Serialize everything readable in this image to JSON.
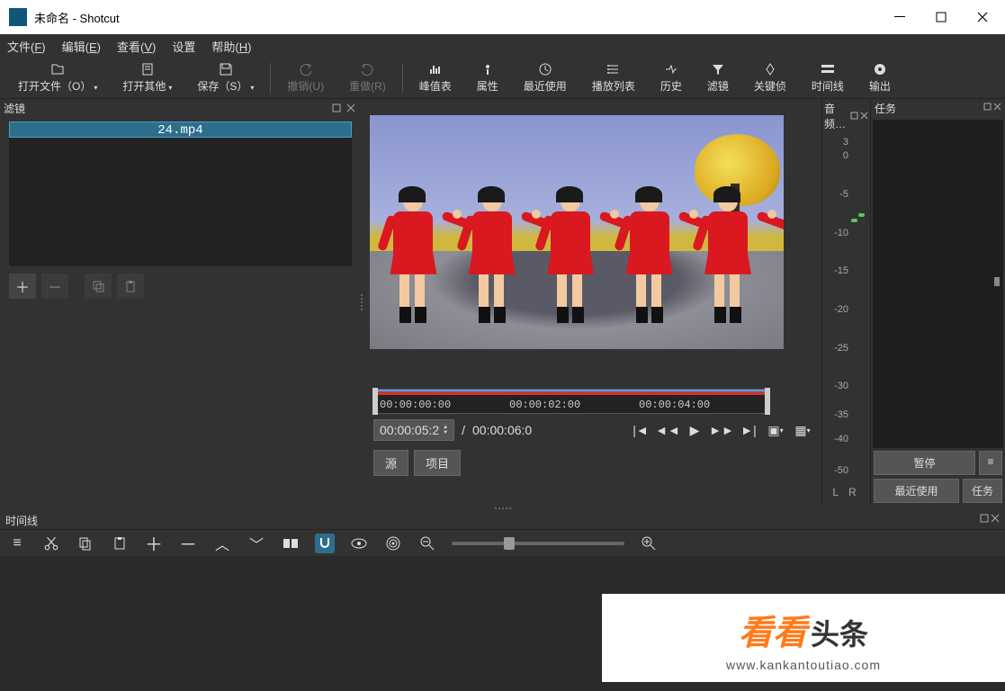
{
  "titlebar": {
    "title": "未命名 - Shotcut"
  },
  "menubar": {
    "file": "文件(",
    "file_u": "F",
    "file2": ")",
    "edit": "编辑(",
    "edit_u": "E",
    "edit2": ")",
    "view": "查看(",
    "view_u": "V",
    "view2": ")",
    "settings": "设置",
    "help": "帮助(",
    "help_u": "H",
    "help2": ")"
  },
  "toolbar": {
    "open_file": "打开文件（O）",
    "open_other": "打开其他",
    "save": "保存（S）",
    "undo": "撤销(U)",
    "redo": "重做(R)",
    "peak": "峰值表",
    "props": "属性",
    "recent": "最近使用",
    "playlist": "播放列表",
    "history": "历史",
    "filters_btn": "滤镜",
    "keyframes": "关键侦",
    "timeline": "时间线",
    "export": "输出"
  },
  "filters": {
    "title": "滤镜",
    "file": "24.mp4"
  },
  "audio": {
    "title": "音频…",
    "scale": [
      "3",
      "0",
      "-5",
      "-10",
      "-15",
      "-20",
      "-25",
      "-30",
      "-35",
      "-40",
      "-50"
    ],
    "lr": "L R"
  },
  "tasks": {
    "title": "任务",
    "pause": "暂停",
    "menu": "≡",
    "recent": "最近使用",
    "tasks_tab": "任务"
  },
  "player": {
    "ruler": {
      "t0": "00:00:00:00",
      "t1": "00:00:02:00",
      "t2": "00:00:04:00"
    },
    "pos": "00:00:05:2",
    "slash": "/",
    "dur": "00:00:06:0",
    "src": "源",
    "project": "项目"
  },
  "timeline": {
    "title": "时间线"
  },
  "watermark": {
    "kk": "看看",
    "tt": "头条",
    "url": "www.kankantoutiao.com"
  }
}
